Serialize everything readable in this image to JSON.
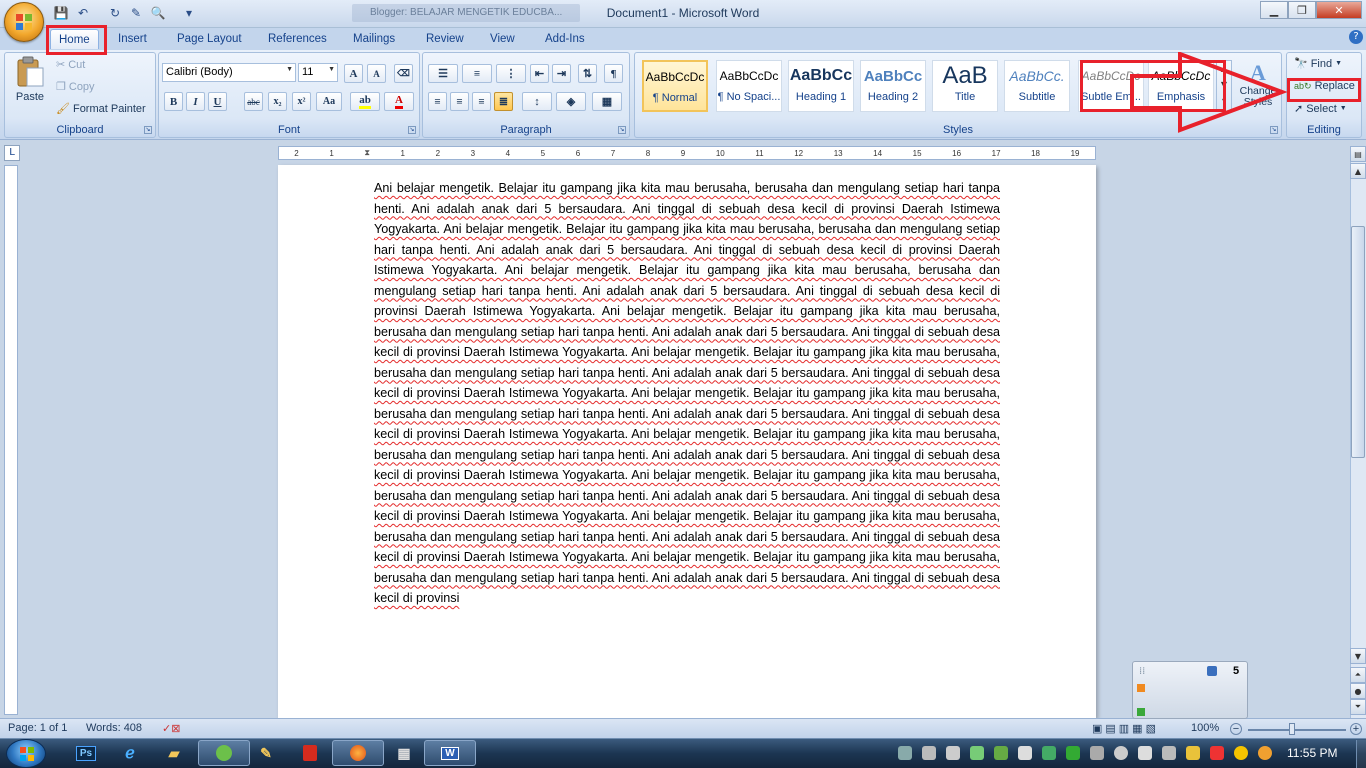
{
  "window": {
    "title": "Document1 - Microsoft Word",
    "background_tab_title": "Blogger: BELAJAR MENGETIK EDUCBA..."
  },
  "tabs": [
    "Home",
    "Insert",
    "Page Layout",
    "References",
    "Mailings",
    "Review",
    "View",
    "Add-Ins"
  ],
  "clipboard": {
    "paste": "Paste",
    "cut": "Cut",
    "copy": "Copy",
    "format_painter": "Format Painter",
    "label": "Clipboard"
  },
  "font": {
    "name": "Calibri (Body)",
    "size": "11",
    "label": "Font",
    "bold": "B",
    "italic": "I",
    "underline": "U",
    "strike": "abc",
    "sub": "x₂",
    "sup": "x²",
    "change_case": "Aa",
    "grow": "A",
    "shrink": "A"
  },
  "paragraph": {
    "label": "Paragraph"
  },
  "styles": {
    "label": "Styles",
    "items": [
      {
        "preview": "AaBbCcDc",
        "name": "¶ Normal"
      },
      {
        "preview": "AaBbCcDc",
        "name": "¶ No Spaci..."
      },
      {
        "preview": "AaBbCc",
        "name": "Heading 1"
      },
      {
        "preview": "AaBbCc",
        "name": "Heading 2"
      },
      {
        "preview": "AaB",
        "name": "Title"
      },
      {
        "preview": "AaBbCc.",
        "name": "Subtitle"
      },
      {
        "preview": "AaBbCcDc",
        "name": "Subtle Em..."
      },
      {
        "preview": "AaBbCcDc",
        "name": "Emphasis"
      }
    ],
    "change_styles": "Change Styles"
  },
  "editing": {
    "label": "Editing",
    "find": "Find",
    "replace": "Replace",
    "select": "Select"
  },
  "ruler_ticks": [
    "2",
    "1",
    "",
    "1",
    "2",
    "3",
    "4",
    "5",
    "6",
    "7",
    "8",
    "9",
    "10",
    "11",
    "12",
    "13",
    "14",
    "15",
    "16",
    "17",
    "18",
    "19"
  ],
  "document": {
    "text": "Ani belajar mengetik. Belajar itu gampang jika kita mau berusaha, berusaha dan mengulang setiap hari tanpa henti. Ani adalah anak dari 5 bersaudara. Ani tinggal di sebuah desa kecil di provinsi Daerah Istimewa Yogyakarta. Ani belajar mengetik. Belajar itu gampang jika kita mau berusaha, berusaha dan mengulang setiap hari tanpa henti. Ani adalah anak dari 5 bersaudara. Ani tinggal di sebuah desa kecil di provinsi Daerah Istimewa Yogyakarta. Ani belajar mengetik. Belajar itu gampang jika kita mau berusaha, berusaha dan mengulang setiap hari tanpa henti. Ani adalah anak dari 5 bersaudara. Ani tinggal di sebuah desa kecil di provinsi Daerah Istimewa Yogyakarta. Ani belajar mengetik. Belajar itu gampang jika kita mau berusaha, berusaha dan mengulang setiap hari tanpa henti. Ani adalah anak dari 5 bersaudara. Ani tinggal di sebuah desa kecil di provinsi Daerah Istimewa Yogyakarta. Ani belajar mengetik. Belajar itu gampang jika kita mau berusaha, berusaha dan mengulang setiap hari tanpa henti. Ani adalah anak dari 5 bersaudara. Ani tinggal di sebuah desa kecil di provinsi Daerah Istimewa Yogyakarta. Ani belajar mengetik. Belajar itu gampang jika kita mau berusaha, berusaha dan mengulang setiap hari tanpa henti. Ani adalah anak dari 5 bersaudara. Ani tinggal di sebuah desa kecil di provinsi Daerah Istimewa Yogyakarta. Ani belajar mengetik. Belajar itu gampang jika kita mau berusaha, berusaha dan mengulang setiap hari tanpa henti. Ani adalah anak dari 5 bersaudara. Ani tinggal di sebuah desa kecil di provinsi Daerah Istimewa Yogyakarta. Ani belajar mengetik. Belajar itu gampang jika kita mau berusaha, berusaha dan mengulang setiap hari tanpa henti. Ani adalah anak dari 5 bersaudara. Ani tinggal di sebuah desa kecil di provinsi Daerah Istimewa Yogyakarta. Ani belajar mengetik. Belajar itu gampang jika kita mau berusaha, berusaha dan mengulang setiap hari tanpa henti. Ani adalah anak dari 5 bersaudara. Ani tinggal di sebuah desa kecil di provinsi Daerah Istimewa Yogyakarta. Ani belajar mengetik. Belajar itu gampang jika kita mau berusaha, berusaha dan mengulang setiap hari tanpa henti. Ani adalah anak dari 5 bersaudara. Ani tinggal di sebuah desa kecil di provinsi"
  },
  "widget": {
    "count": "5"
  },
  "status": {
    "page": "Page: 1 of 1",
    "words": "Words: 408",
    "zoom": "100%"
  },
  "taskbar": {
    "ps": "Ps",
    "word": "W",
    "clock": "11:55 PM"
  },
  "colors": {
    "highlight": "#e8212b",
    "ribbon_text": "#15428b"
  }
}
